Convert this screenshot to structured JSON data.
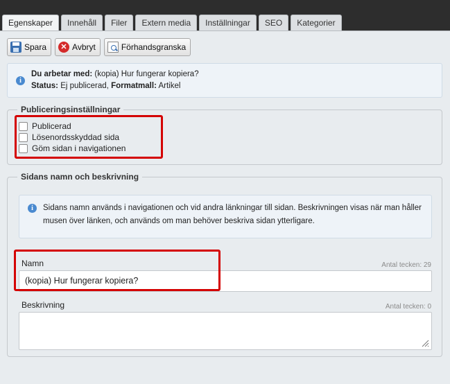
{
  "tabs": [
    {
      "label": "Egenskaper"
    },
    {
      "label": "Innehåll"
    },
    {
      "label": "Filer"
    },
    {
      "label": "Extern media"
    },
    {
      "label": "Inställningar"
    },
    {
      "label": "SEO"
    },
    {
      "label": "Kategorier"
    }
  ],
  "toolbar": {
    "save_label": "Spara",
    "cancel_label": "Avbryt",
    "preview_label": "Förhandsgranska"
  },
  "info": {
    "working_label": "Du arbetar med:",
    "working_value": "(kopia) Hur fungerar kopiera?",
    "status_label": "Status:",
    "status_value": "Ej publicerad,",
    "template_label": "Formatmall:",
    "template_value": "Artikel"
  },
  "publishing": {
    "legend": "Publiceringsinställningar",
    "options": [
      {
        "label": "Publicerad",
        "checked": false
      },
      {
        "label": "Lösenordsskyddad sida",
        "checked": false
      },
      {
        "label": "Göm sidan i navigationen",
        "checked": false
      }
    ]
  },
  "page_info": {
    "legend": "Sidans namn och beskrivning",
    "help_text": "Sidans namn används i navigationen och vid andra länkningar till sidan. Beskrivningen visas när man håller musen över länken, och används om man behöver beskriva sidan ytterligare.",
    "name_label": "Namn",
    "name_counter_label": "Antal tecken:",
    "name_counter_value": "29",
    "name_value": "(kopia) Hur fungerar kopiera?",
    "description_label": "Beskrivning",
    "description_counter_label": "Antal tecken:",
    "description_counter_value": "0",
    "description_value": ""
  },
  "colors": {
    "highlight": "#d40000",
    "background": "#e8ecef",
    "info_background": "#eef3f8"
  }
}
